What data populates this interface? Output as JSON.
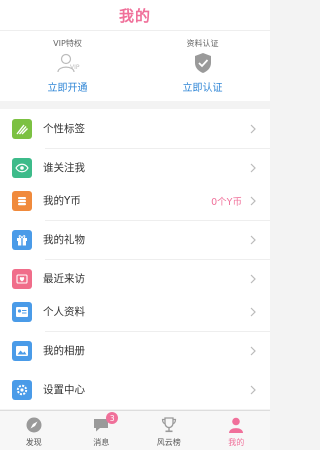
{
  "header": {
    "title": "我的"
  },
  "vip": {
    "left": {
      "label": "VIP特权",
      "action": "立即开通",
      "icon": "vip-user-icon"
    },
    "right": {
      "label": "资料认证",
      "action": "立即认证",
      "icon": "shield-check-icon"
    }
  },
  "menu": [
    {
      "label": "个性标签",
      "icon": "tag-icon",
      "color": "#7cc142",
      "extra": ""
    },
    {
      "label": "谁关注我",
      "icon": "eye-icon",
      "color": "#3dbb8a",
      "extra": ""
    },
    {
      "label": "我的Y币",
      "icon": "coin-stack-icon",
      "color": "#f08a3c",
      "extra": "0个Y币"
    },
    {
      "label": "我的礼物",
      "icon": "gift-icon",
      "color": "#4a9be8",
      "extra": ""
    },
    {
      "label": "最近来访",
      "icon": "visitor-icon",
      "color": "#f06d8a",
      "extra": ""
    },
    {
      "label": "个人资料",
      "icon": "id-card-icon",
      "color": "#4a9be8",
      "extra": ""
    },
    {
      "label": "我的相册",
      "icon": "album-icon",
      "color": "#4a9be8",
      "extra": ""
    },
    {
      "label": "设置中心",
      "icon": "gear-icon",
      "color": "#4a9be8",
      "extra": ""
    }
  ],
  "tabs": [
    {
      "label": "发现",
      "icon": "compass-icon"
    },
    {
      "label": "消息",
      "icon": "chat-icon",
      "badge": "3"
    },
    {
      "label": "风云榜",
      "icon": "trophy-icon"
    },
    {
      "label": "我的",
      "icon": "profile-icon"
    }
  ],
  "colors": {
    "accent": "#f0709a",
    "link": "#2f86d6"
  }
}
